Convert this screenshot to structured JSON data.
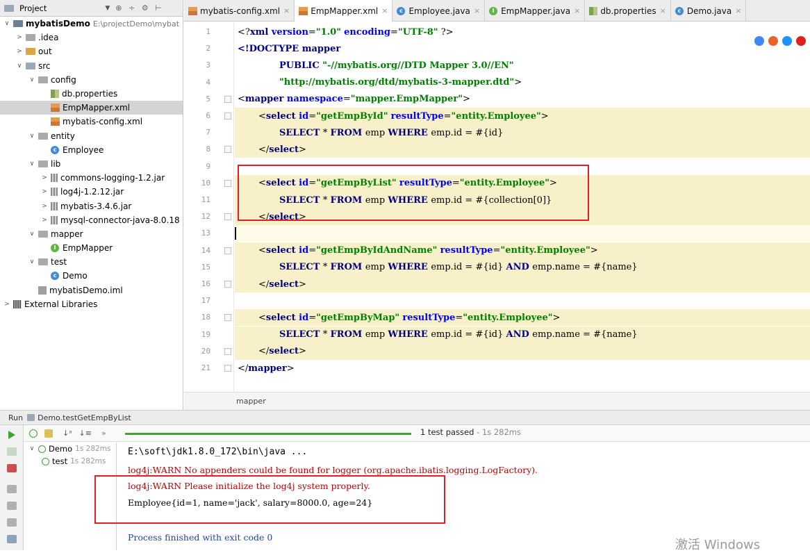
{
  "project_panel": {
    "title": "Project",
    "tree": [
      {
        "label": "mybatisDemo",
        "extra": "E:\\projectDemo\\mybat",
        "depth": 0,
        "arrow": "∨",
        "icon": "module",
        "bold": true
      },
      {
        "label": ".idea",
        "depth": 1,
        "arrow": ">",
        "icon": "folder"
      },
      {
        "label": "out",
        "depth": 1,
        "arrow": ">",
        "icon": "folder-orange"
      },
      {
        "label": "src",
        "depth": 1,
        "arrow": "∨",
        "icon": "folder-blue"
      },
      {
        "label": "config",
        "depth": 2,
        "arrow": "∨",
        "icon": "folder"
      },
      {
        "label": "db.properties",
        "depth": 3,
        "arrow": "",
        "icon": "props"
      },
      {
        "label": "EmpMapper.xml",
        "depth": 3,
        "arrow": "",
        "icon": "xml",
        "selected": true
      },
      {
        "label": "mybatis-config.xml",
        "depth": 3,
        "arrow": "",
        "icon": "xml"
      },
      {
        "label": "entity",
        "depth": 2,
        "arrow": "∨",
        "icon": "folder"
      },
      {
        "label": "Employee",
        "depth": 3,
        "arrow": "",
        "icon": "class-c"
      },
      {
        "label": "lib",
        "depth": 2,
        "arrow": "∨",
        "icon": "folder"
      },
      {
        "label": "commons-logging-1.2.jar",
        "depth": 3,
        "arrow": ">",
        "icon": "jar"
      },
      {
        "label": "log4j-1.2.12.jar",
        "depth": 3,
        "arrow": ">",
        "icon": "jar"
      },
      {
        "label": "mybatis-3.4.6.jar",
        "depth": 3,
        "arrow": ">",
        "icon": "jar"
      },
      {
        "label": "mysql-connector-java-8.0.18",
        "depth": 3,
        "arrow": ">",
        "icon": "jar"
      },
      {
        "label": "mapper",
        "depth": 2,
        "arrow": "∨",
        "icon": "folder"
      },
      {
        "label": "EmpMapper",
        "depth": 3,
        "arrow": "",
        "icon": "class-i"
      },
      {
        "label": "test",
        "depth": 2,
        "arrow": "∨",
        "icon": "folder"
      },
      {
        "label": "Demo",
        "depth": 3,
        "arrow": "",
        "icon": "class-c"
      },
      {
        "label": "mybatisDemo.iml",
        "depth": 2,
        "arrow": "",
        "icon": "iml"
      },
      {
        "label": "External Libraries",
        "depth": 0,
        "arrow": ">",
        "icon": "libs"
      }
    ]
  },
  "tabs": [
    {
      "label": "mybatis-config.xml",
      "icon": "xml",
      "active": false
    },
    {
      "label": "EmpMapper.xml",
      "icon": "xml",
      "active": true
    },
    {
      "label": "Employee.java",
      "icon": "class-c",
      "active": false
    },
    {
      "label": "EmpMapper.java",
      "icon": "class-i",
      "active": false
    },
    {
      "label": "db.properties",
      "icon": "props",
      "active": false
    },
    {
      "label": "Demo.java",
      "icon": "class-c",
      "active": false
    }
  ],
  "tab_close": "×",
  "editor": {
    "lines": [
      {
        "n": "1",
        "indent": 0,
        "parts": [
          [
            "plain",
            "<?"
          ],
          [
            "tag",
            "xml "
          ],
          [
            "attr",
            "version"
          ],
          [
            "plain",
            "="
          ],
          [
            "str",
            "\"1.0\""
          ],
          [
            "plain",
            " "
          ],
          [
            "attr",
            "encoding"
          ],
          [
            "plain",
            "="
          ],
          [
            "str",
            "\"UTF-8\""
          ],
          [
            "plain",
            " ?>"
          ]
        ]
      },
      {
        "n": "2",
        "indent": 0,
        "parts": [
          [
            "tag",
            "<!DOCTYPE mapper"
          ]
        ]
      },
      {
        "n": "3",
        "indent": 2,
        "parts": [
          [
            "tag",
            "PUBLIC "
          ],
          [
            "str",
            "\"-//mybatis.org//DTD Mapper 3.0//EN\""
          ]
        ]
      },
      {
        "n": "4",
        "indent": 2,
        "parts": [
          [
            "str",
            "\"http://mybatis.org/dtd/mybatis-3-mapper.dtd\""
          ],
          [
            "plain",
            ">"
          ]
        ]
      },
      {
        "n": "5",
        "indent": 0,
        "parts": [
          [
            "plain",
            "<"
          ],
          [
            "tag",
            "mapper "
          ],
          [
            "attr",
            "namespace"
          ],
          [
            "plain",
            "="
          ],
          [
            "str",
            "\"mapper.EmpMapper\""
          ],
          [
            "plain",
            ">"
          ]
        ]
      },
      {
        "n": "6",
        "indent": 1,
        "hl": true,
        "parts": [
          [
            "plain",
            "<"
          ],
          [
            "tag",
            "select "
          ],
          [
            "attr",
            "id"
          ],
          [
            "plain",
            "="
          ],
          [
            "str",
            "\"getEmpById\""
          ],
          [
            "plain",
            " "
          ],
          [
            "attr",
            "resultType"
          ],
          [
            "plain",
            "="
          ],
          [
            "str",
            "\"entity.Employee\""
          ],
          [
            "plain",
            ">"
          ]
        ]
      },
      {
        "n": "7",
        "indent": 2,
        "hl": true,
        "parts": [
          [
            "sql",
            "SELECT "
          ],
          [
            "plain",
            "* "
          ],
          [
            "sql",
            "FROM "
          ],
          [
            "plain",
            "emp "
          ],
          [
            "sql",
            "WHERE "
          ],
          [
            "plain",
            "emp.id = #{id}"
          ]
        ]
      },
      {
        "n": "8",
        "indent": 1,
        "hl": true,
        "parts": [
          [
            "plain",
            "</"
          ],
          [
            "tag",
            "select"
          ],
          [
            "plain",
            ">"
          ]
        ]
      },
      {
        "n": "9",
        "indent": 0,
        "parts": []
      },
      {
        "n": "10",
        "indent": 1,
        "hl": true,
        "parts": [
          [
            "plain",
            "<"
          ],
          [
            "tag",
            "select "
          ],
          [
            "attr",
            "id"
          ],
          [
            "plain",
            "="
          ],
          [
            "str",
            "\"getEmpByList\""
          ],
          [
            "plain",
            " "
          ],
          [
            "attr",
            "resultType"
          ],
          [
            "plain",
            "="
          ],
          [
            "str",
            "\"entity.Employee\""
          ],
          [
            "plain",
            ">"
          ]
        ]
      },
      {
        "n": "11",
        "indent": 2,
        "hl": true,
        "parts": [
          [
            "sql",
            "SELECT "
          ],
          [
            "plain",
            "* "
          ],
          [
            "sql",
            "FROM "
          ],
          [
            "plain",
            "emp "
          ],
          [
            "sql",
            "WHERE "
          ],
          [
            "plain",
            "emp.id = #{collection[0]}"
          ]
        ]
      },
      {
        "n": "12",
        "indent": 1,
        "hl": true,
        "parts": [
          [
            "plain",
            "</"
          ],
          [
            "tag",
            "select"
          ],
          [
            "plain",
            ">"
          ]
        ]
      },
      {
        "n": "13",
        "indent": 0,
        "cur": true,
        "parts": []
      },
      {
        "n": "14",
        "indent": 1,
        "hl": true,
        "parts": [
          [
            "plain",
            "<"
          ],
          [
            "tag",
            "select "
          ],
          [
            "attr",
            "id"
          ],
          [
            "plain",
            "="
          ],
          [
            "str",
            "\"getEmpByIdAndName\""
          ],
          [
            "plain",
            " "
          ],
          [
            "attr",
            "resultType"
          ],
          [
            "plain",
            "="
          ],
          [
            "str",
            "\"entity.Employee\""
          ],
          [
            "plain",
            ">"
          ]
        ]
      },
      {
        "n": "15",
        "indent": 2,
        "hl": true,
        "parts": [
          [
            "sql",
            "SELECT "
          ],
          [
            "plain",
            "* "
          ],
          [
            "sql",
            "FROM "
          ],
          [
            "plain",
            "emp "
          ],
          [
            "sql",
            "WHERE "
          ],
          [
            "plain",
            "emp.id = #{id} "
          ],
          [
            "sql",
            "AND "
          ],
          [
            "plain",
            "emp.name = #{name}"
          ]
        ]
      },
      {
        "n": "16",
        "indent": 1,
        "hl": true,
        "parts": [
          [
            "plain",
            "</"
          ],
          [
            "tag",
            "select"
          ],
          [
            "plain",
            ">"
          ]
        ]
      },
      {
        "n": "17",
        "indent": 0,
        "parts": []
      },
      {
        "n": "18",
        "indent": 1,
        "hl": true,
        "parts": [
          [
            "plain",
            "<"
          ],
          [
            "tag",
            "select "
          ],
          [
            "attr",
            "id"
          ],
          [
            "plain",
            "="
          ],
          [
            "str",
            "\"getEmpByMap\""
          ],
          [
            "plain",
            " "
          ],
          [
            "attr",
            "resultType"
          ],
          [
            "plain",
            "="
          ],
          [
            "str",
            "\"entity.Employee\""
          ],
          [
            "plain",
            ">"
          ]
        ]
      },
      {
        "n": "19",
        "indent": 2,
        "hl": true,
        "parts": [
          [
            "sql",
            "SELECT "
          ],
          [
            "plain",
            "* "
          ],
          [
            "sql",
            "FROM "
          ],
          [
            "plain",
            "emp "
          ],
          [
            "sql",
            "WHERE "
          ],
          [
            "plain",
            "emp.id = #{id} "
          ],
          [
            "sql",
            "AND "
          ],
          [
            "plain",
            "emp.name = #{name}"
          ]
        ]
      },
      {
        "n": "20",
        "indent": 1,
        "hl": true,
        "parts": [
          [
            "plain",
            "</"
          ],
          [
            "tag",
            "select"
          ],
          [
            "plain",
            ">"
          ]
        ]
      },
      {
        "n": "21",
        "indent": 0,
        "parts": [
          [
            "plain",
            "</"
          ],
          [
            "tag",
            "mapper"
          ],
          [
            "plain",
            ">"
          ]
        ]
      }
    ],
    "breadcrumb": "mapper",
    "browser_icons": [
      "#4285f4",
      "#e8622c",
      "#1e90ff",
      "#e0201f"
    ]
  },
  "run": {
    "title_prefix": "Run",
    "title": "Demo.testGetEmpByList",
    "status": "1 test passed",
    "status_time": "- 1s 282ms",
    "tree": [
      {
        "label": "Demo",
        "time": "1s 282ms",
        "depth": 0
      },
      {
        "label": "test",
        "time": "1s 282ms",
        "depth": 1
      }
    ],
    "console": [
      {
        "text": "E:\\soft\\jdk1.8.0_172\\bin\\java ...",
        "style": "cmd"
      },
      {
        "text": "log4j:WARN No appenders could be found for logger (org.apache.ibatis.logging.LogFactory).",
        "style": "red"
      },
      {
        "text": "log4j:WARN Please initialize the log4j system properly.",
        "style": "red"
      },
      {
        "text": "Employee{id=1, name='jack', salary=8000.0, age=24}",
        "style": "plain"
      },
      {
        "text": "",
        "style": "plain"
      },
      {
        "text": "Process finished with exit code 0",
        "style": "blue"
      }
    ]
  },
  "watermark": "激活 Windows"
}
